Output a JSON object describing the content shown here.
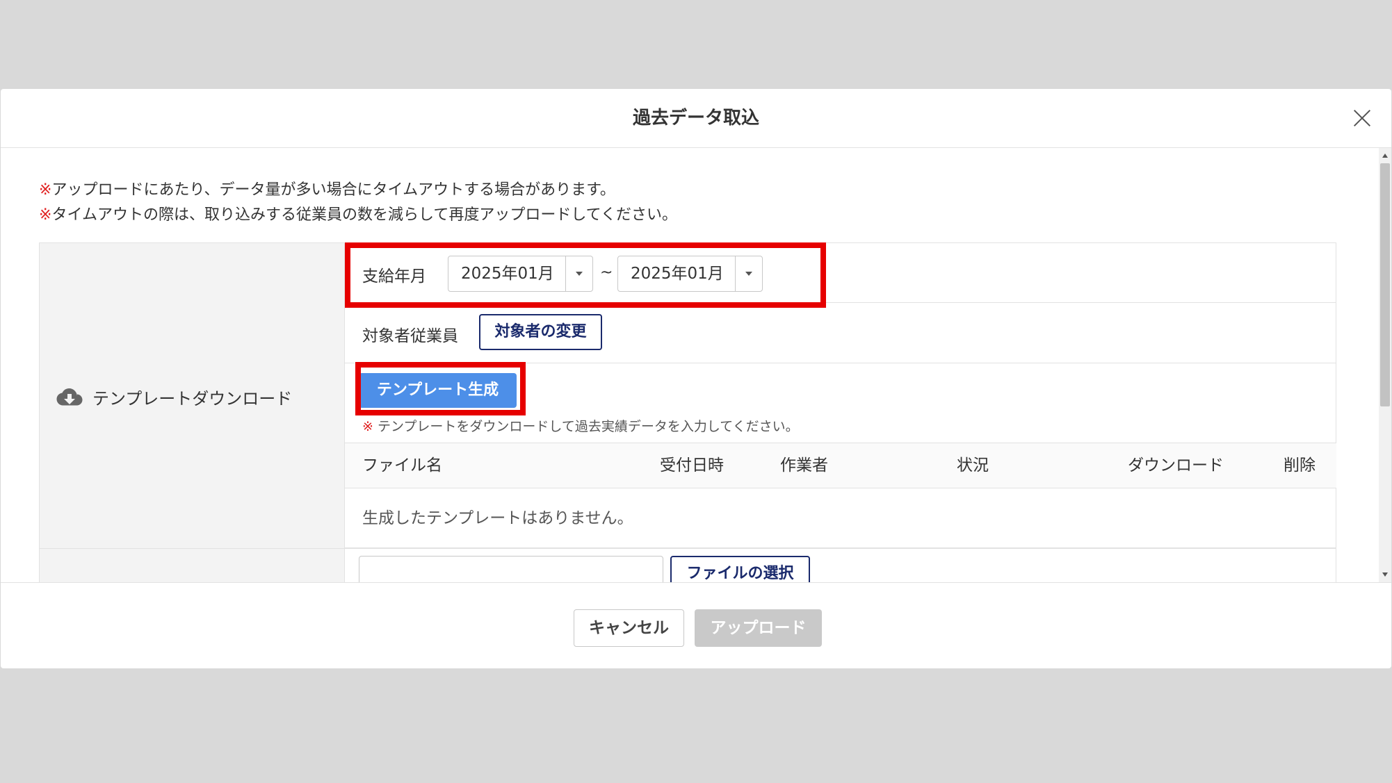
{
  "modal": {
    "title": "過去データ取込",
    "notices": [
      {
        "mark": "※",
        "text": "アップロードにあたり、データ量が多い場合にタイムアウトする場合があります。"
      },
      {
        "mark": "※",
        "text": "タイムアウトの際は、取り込みする従業員の数を減らして再度アップロードしてください。"
      }
    ]
  },
  "template_section": {
    "label": "テンプレートダウンロード",
    "icon": "cloud-download-icon",
    "pay_period": {
      "label": "支給年月",
      "from": "2025年01月",
      "separator": "~",
      "to": "2025年01月"
    },
    "target_employees": {
      "label": "対象者従業員",
      "change_button": "対象者の変更"
    },
    "generate_button": "テンプレート生成",
    "hint": {
      "mark": "※",
      "text": " テンプレートをダウンロードして過去実績データを入力してください。"
    },
    "table": {
      "headers": [
        "ファイル名",
        "受付日時",
        "作業者",
        "状況",
        "ダウンロード",
        "削除"
      ],
      "empty_message": "生成したテンプレートはありません。"
    }
  },
  "upload_section": {
    "file_value": "",
    "select_button": "ファイルの選択"
  },
  "footer": {
    "cancel": "キャンセル",
    "upload": "アップロード"
  },
  "colors": {
    "highlight": "#e60000",
    "primary": "#4d8fe8",
    "navy": "#1a2a6c",
    "disabled": "#c9c9c9"
  }
}
